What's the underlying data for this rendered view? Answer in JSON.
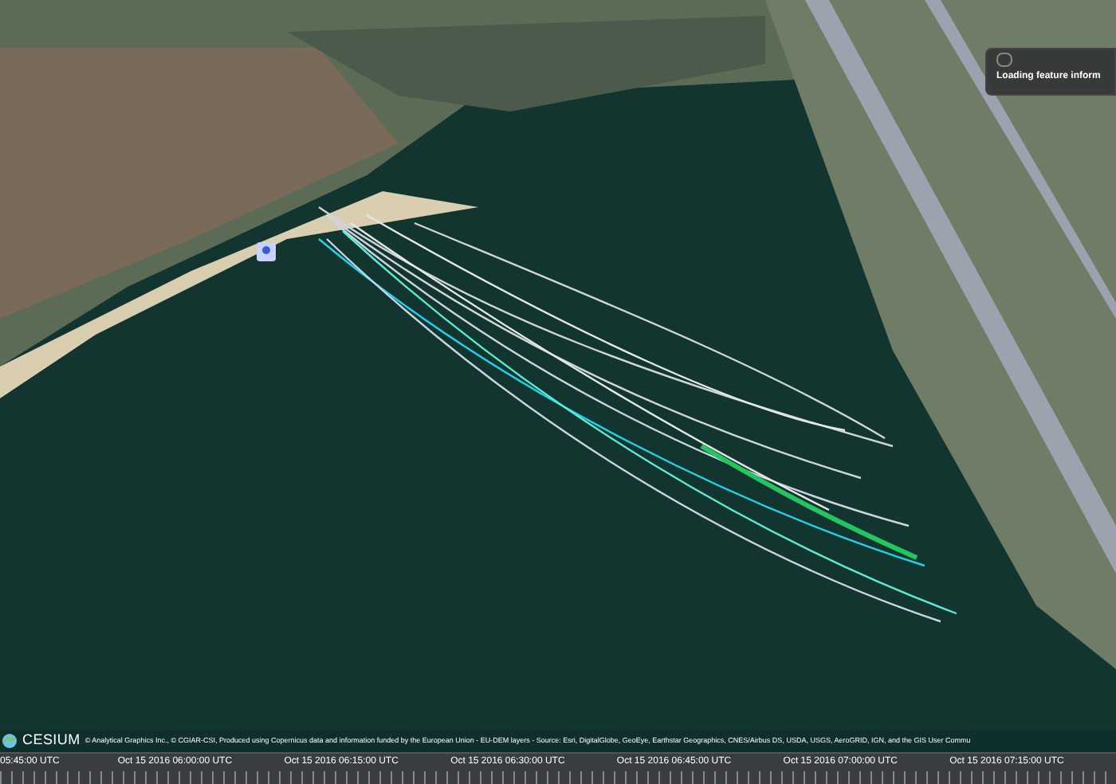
{
  "infobox": {
    "title": "Loading feature inform"
  },
  "credits": {
    "logo": "CESIUM",
    "text": "© Analytical Graphics Inc., © CGIAR-CSI, Produced using Copernicus data and information funded by the European Union - EU-DEM layers - Source: Esri, DigitalGlobe, GeoEye, Earthstar Geographics, CNES/Airbus DS, USDA, USGS, AeroGRID, IGN, and the GIS User Commu"
  },
  "timeline": {
    "labels": [
      "05:45:00 UTC",
      "Oct 15 2016 06:00:00 UTC",
      "Oct 15 2016 06:15:00 UTC",
      "Oct 15 2016 06:30:00 UTC",
      "Oct 15 2016 06:45:00 UTC",
      "Oct 15 2016 07:00:00 UTC",
      "Oct 15 2016 07:15:00 UTC"
    ]
  }
}
